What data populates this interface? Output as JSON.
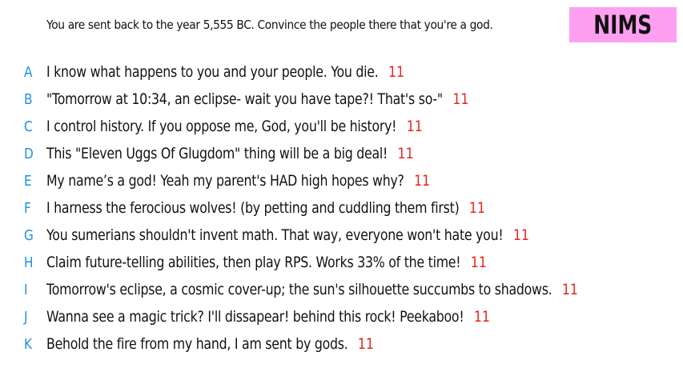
{
  "prompt": "You are sent back to the year 5,555 BC. Convince the people there that you're a god.",
  "badge": {
    "label": "NIMS",
    "color": "#ff9ff2"
  },
  "colors": {
    "letter": "#1e90e0",
    "score": "#e8231f"
  },
  "answers": [
    {
      "letter": "A",
      "text": "I know what happens to you and your people. You die.",
      "score": "11"
    },
    {
      "letter": "B",
      "text": "\"Tomorrow at 10:34, an eclipse- wait you have tape?! That's so-\"",
      "score": "11"
    },
    {
      "letter": "C",
      "text": "I control history. If you oppose me, God, you'll be history!",
      "score": "11"
    },
    {
      "letter": "D",
      "text": "This \"Eleven Uggs Of Glugdom\" thing will be a big deal!",
      "score": "11"
    },
    {
      "letter": "E",
      "text": "My name’s a god! Yeah my parent's HAD high hopes why?",
      "score": "11"
    },
    {
      "letter": "F",
      "text": "I harness the ferocious wolves! (by petting and cuddling them first)",
      "score": "11"
    },
    {
      "letter": "G",
      "text": "You sumerians shouldn't invent math. That way, everyone won't hate you!",
      "score": "11"
    },
    {
      "letter": "H",
      "text": "Claim future-telling abilities, then play RPS. Works 33% of the time!",
      "score": "11"
    },
    {
      "letter": "I",
      "text": "Tomorrow's eclipse, a cosmic cover-up; the sun's silhouette succumbs to shadows.",
      "score": "11"
    },
    {
      "letter": "J",
      "text": "Wanna see a magic trick? I'll dissapear! behind this rock! Peekaboo!",
      "score": "11"
    },
    {
      "letter": "K",
      "text": "Behold the fire from my hand, I am sent by gods.",
      "score": "11"
    }
  ]
}
